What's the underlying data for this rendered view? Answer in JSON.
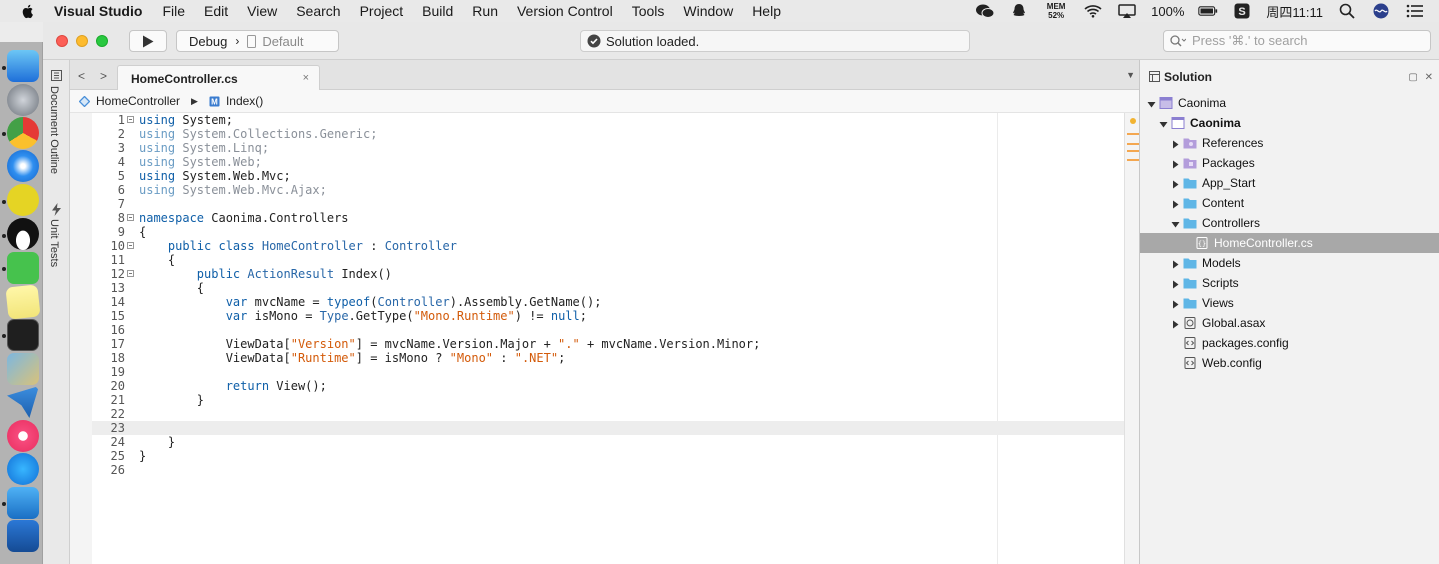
{
  "menubar": {
    "app_name": "Visual Studio",
    "items": [
      "File",
      "Edit",
      "View",
      "Search",
      "Project",
      "Build",
      "Run",
      "Version Control",
      "Tools",
      "Window",
      "Help"
    ],
    "mem_label": "MEM",
    "mem_value": "52%",
    "battery": "100%",
    "clock": "周四11:11"
  },
  "toolbar": {
    "configuration": "Debug",
    "target": "Default",
    "status": "Solution loaded.",
    "search_placeholder": "Press '⌘.' to search"
  },
  "pads_left": [
    "Document Outline",
    "Unit Tests"
  ],
  "tab": {
    "title": "HomeController.cs",
    "close": "×"
  },
  "breadcrumb": {
    "class_name": "HomeController",
    "method_name": "Index()"
  },
  "editor": {
    "current_line": 23,
    "lines": [
      {
        "n": "1",
        "fold": true,
        "tokens": [
          [
            "kw",
            "using"
          ],
          [
            "",
            "System;"
          ]
        ]
      },
      {
        "n": "2",
        "fold": false,
        "tokens": [
          [
            "dimkw",
            "using"
          ],
          [
            "dim",
            "System.Collections.Generic;"
          ]
        ]
      },
      {
        "n": "3",
        "fold": false,
        "tokens": [
          [
            "dimkw",
            "using"
          ],
          [
            "dim",
            "System.Linq;"
          ]
        ]
      },
      {
        "n": "4",
        "fold": false,
        "tokens": [
          [
            "dimkw",
            "using"
          ],
          [
            "dim",
            "System.Web;"
          ]
        ]
      },
      {
        "n": "5",
        "fold": false,
        "tokens": [
          [
            "kw",
            "using"
          ],
          [
            "",
            "System.Web.Mvc;"
          ]
        ]
      },
      {
        "n": "6",
        "fold": false,
        "tokens": [
          [
            "dimkw",
            "using"
          ],
          [
            "dim",
            "System.Web.Mvc.Ajax;"
          ]
        ]
      },
      {
        "n": "7",
        "fold": false,
        "tokens": []
      },
      {
        "n": "8",
        "fold": true,
        "tokens": [
          [
            "kw",
            "namespace"
          ],
          [
            "",
            " Caonima.Controllers"
          ]
        ]
      },
      {
        "n": "9",
        "fold": false,
        "tokens": [
          [
            "",
            "{"
          ]
        ]
      },
      {
        "n": "10",
        "fold": true,
        "tokens": [
          [
            "",
            "    "
          ],
          [
            "kw",
            "public class"
          ],
          [
            "",
            " "
          ],
          [
            "type",
            "HomeController"
          ],
          [
            "",
            " : "
          ],
          [
            "type",
            "Controller"
          ]
        ]
      },
      {
        "n": "11",
        "fold": false,
        "tokens": [
          [
            "",
            "    {"
          ]
        ]
      },
      {
        "n": "12",
        "fold": true,
        "tokens": [
          [
            "",
            "        "
          ],
          [
            "kw",
            "public"
          ],
          [
            "",
            " "
          ],
          [
            "type",
            "ActionResult"
          ],
          [
            "",
            " Index()"
          ]
        ]
      },
      {
        "n": "13",
        "fold": false,
        "tokens": [
          [
            "",
            "        {"
          ]
        ]
      },
      {
        "n": "14",
        "fold": false,
        "tokens": [
          [
            "",
            "            "
          ],
          [
            "kw",
            "var"
          ],
          [
            "",
            " mvcName = "
          ],
          [
            "kw",
            "typeof"
          ],
          [
            "",
            "("
          ],
          [
            "type",
            "Controller"
          ],
          [
            "",
            ").Assembly.GetName();"
          ]
        ]
      },
      {
        "n": "15",
        "fold": false,
        "tokens": [
          [
            "",
            "            "
          ],
          [
            "kw",
            "var"
          ],
          [
            "",
            " isMono = "
          ],
          [
            "type",
            "Type"
          ],
          [
            "",
            ".GetType("
          ],
          [
            "str",
            "\"Mono.Runtime\""
          ],
          [
            "",
            ") != "
          ],
          [
            "kw",
            "null"
          ],
          [
            "",
            ";"
          ]
        ]
      },
      {
        "n": "16",
        "fold": false,
        "tokens": []
      },
      {
        "n": "17",
        "fold": false,
        "tokens": [
          [
            "",
            "            ViewData["
          ],
          [
            "str",
            "\"Version\""
          ],
          [
            "",
            "] = mvcName.Version.Major + "
          ],
          [
            "str",
            "\".\""
          ],
          [
            "",
            " + mvcName.Version.Minor;"
          ]
        ]
      },
      {
        "n": "18",
        "fold": false,
        "tokens": [
          [
            "",
            "            ViewData["
          ],
          [
            "str",
            "\"Runtime\""
          ],
          [
            "",
            "] = isMono ? "
          ],
          [
            "str",
            "\"Mono\""
          ],
          [
            "",
            " : "
          ],
          [
            "str",
            "\".NET\""
          ],
          [
            "",
            ";"
          ]
        ]
      },
      {
        "n": "19",
        "fold": false,
        "tokens": []
      },
      {
        "n": "20",
        "fold": false,
        "tokens": [
          [
            "",
            "            "
          ],
          [
            "kw",
            "return"
          ],
          [
            "",
            " View();"
          ]
        ]
      },
      {
        "n": "21",
        "fold": false,
        "tokens": [
          [
            "",
            "        }"
          ]
        ]
      },
      {
        "n": "22",
        "fold": false,
        "tokens": []
      },
      {
        "n": "23",
        "fold": false,
        "tokens": []
      },
      {
        "n": "24",
        "fold": false,
        "tokens": [
          [
            "",
            "    }"
          ]
        ]
      },
      {
        "n": "25",
        "fold": false,
        "tokens": [
          [
            "",
            "}"
          ]
        ]
      },
      {
        "n": "26",
        "fold": false,
        "tokens": []
      }
    ]
  },
  "solution": {
    "title": "Solution",
    "tree": [
      {
        "label": "Caonima",
        "depth": 0,
        "expanded": true,
        "icon": "solution-icon",
        "bold": false
      },
      {
        "label": "Caonima",
        "depth": 1,
        "expanded": true,
        "icon": "project-icon",
        "bold": true
      },
      {
        "label": "References",
        "depth": 2,
        "expanded": false,
        "icon": "references-folder-icon",
        "bold": false
      },
      {
        "label": "Packages",
        "depth": 2,
        "expanded": false,
        "icon": "packages-folder-icon",
        "bold": false
      },
      {
        "label": "App_Start",
        "depth": 2,
        "expanded": false,
        "icon": "folder-icon",
        "bold": false
      },
      {
        "label": "Content",
        "depth": 2,
        "expanded": false,
        "icon": "folder-icon",
        "bold": false
      },
      {
        "label": "Controllers",
        "depth": 2,
        "expanded": true,
        "icon": "folder-icon",
        "bold": false
      },
      {
        "label": "HomeController.cs",
        "depth": 3,
        "expanded": null,
        "icon": "cs-file-icon",
        "bold": false,
        "selected": true
      },
      {
        "label": "Models",
        "depth": 2,
        "expanded": false,
        "icon": "folder-icon",
        "bold": false
      },
      {
        "label": "Scripts",
        "depth": 2,
        "expanded": false,
        "icon": "folder-icon",
        "bold": false
      },
      {
        "label": "Views",
        "depth": 2,
        "expanded": false,
        "icon": "folder-icon",
        "bold": false
      },
      {
        "label": "Global.asax",
        "depth": 2,
        "expanded": false,
        "icon": "asax-file-icon",
        "bold": false
      },
      {
        "label": "packages.config",
        "depth": 2,
        "expanded": null,
        "icon": "config-file-icon",
        "bold": false
      },
      {
        "label": "Web.config",
        "depth": 2,
        "expanded": null,
        "icon": "config-file-icon",
        "bold": false
      }
    ]
  },
  "colors": {
    "folder": "#5fb6e6",
    "special_folder": "#b39ddb",
    "project": "#8b7fd1",
    "keyword": "#0f5fa8",
    "string": "#d35a09"
  }
}
